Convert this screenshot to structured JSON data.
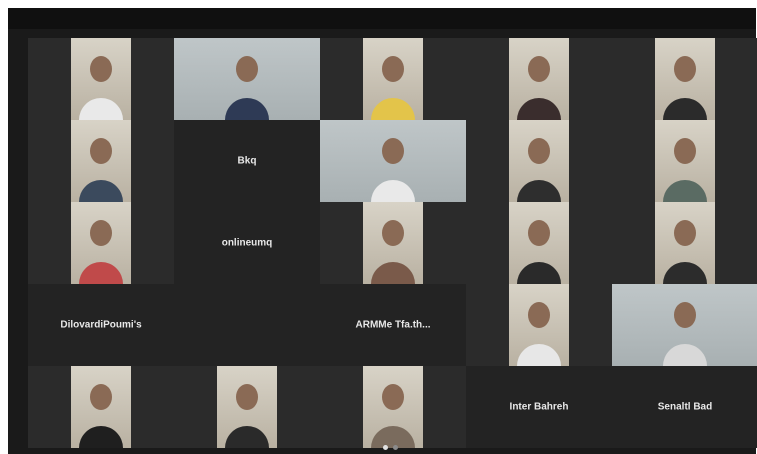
{
  "meeting": {
    "tiles": [
      {
        "type": "video",
        "name": ""
      },
      {
        "type": "video",
        "name": ""
      },
      {
        "type": "video",
        "name": ""
      },
      {
        "type": "video",
        "name": ""
      },
      {
        "type": "video",
        "name": ""
      },
      {
        "type": "video",
        "name": ""
      },
      {
        "type": "name",
        "name": "Bkq",
        "label": ""
      },
      {
        "type": "video",
        "name": "",
        "speaker": true
      },
      {
        "type": "video",
        "name": ""
      },
      {
        "type": "video",
        "name": ""
      },
      {
        "type": "video",
        "name": ""
      },
      {
        "type": "name",
        "name": "onlineumq",
        "label": ""
      },
      {
        "type": "video",
        "name": ""
      },
      {
        "type": "video",
        "name": ""
      },
      {
        "type": "video",
        "name": ""
      },
      {
        "type": "name",
        "name": "DilovardiPoumi's",
        "label": ""
      },
      {
        "type": "empty",
        "name": ""
      },
      {
        "type": "name",
        "name": "ARMMe Tfa.th...",
        "label": ""
      },
      {
        "type": "video",
        "name": ""
      },
      {
        "type": "video",
        "name": ""
      },
      {
        "type": "video",
        "name": ""
      },
      {
        "type": "video",
        "name": ""
      },
      {
        "type": "video",
        "name": ""
      },
      {
        "type": "name",
        "name": "Inter Bahreh",
        "label": ""
      },
      {
        "type": "name",
        "name": "Senaltl Bad",
        "label": ""
      }
    ]
  },
  "pager": {
    "pages": 2,
    "current": 1
  }
}
